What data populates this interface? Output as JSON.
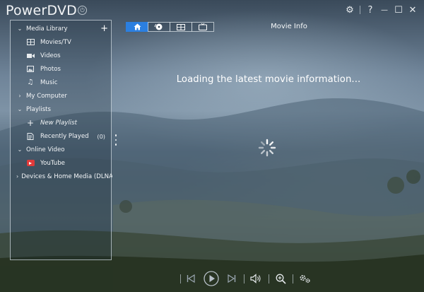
{
  "app": {
    "title": "PowerDVD",
    "badge_glyph": "⏻"
  },
  "window_controls": {
    "settings_glyph": "⚙",
    "help_glyph": "?",
    "minimize_glyph": "—",
    "maximize_glyph": "☐",
    "close_glyph": "✕"
  },
  "sidebar": {
    "media_library": {
      "label": "Media Library",
      "add_glyph": "+",
      "items": [
        {
          "label": "Movies/TV",
          "icon": "film-icon"
        },
        {
          "label": "Videos",
          "icon": "video-camera-icon"
        },
        {
          "label": "Photos",
          "icon": "photo-icon"
        },
        {
          "label": "Music",
          "icon": "music-note-icon"
        }
      ]
    },
    "my_computer": {
      "label": "My Computer"
    },
    "playlists": {
      "label": "Playlists",
      "new_playlist": "New Playlist",
      "recently_played": "Recently Played",
      "recently_played_count": "(0)"
    },
    "online_video": {
      "label": "Online Video",
      "youtube": "YouTube"
    },
    "devices": {
      "label": "Devices & Home Media (DLNA)"
    }
  },
  "tabs": [
    {
      "name": "home",
      "icon": "home-icon",
      "active": true
    },
    {
      "name": "disc",
      "icon": "disc-icon",
      "active": false
    },
    {
      "name": "film-strip",
      "icon": "film-strip-icon",
      "active": false
    },
    {
      "name": "tv",
      "icon": "tv-icon",
      "active": false
    }
  ],
  "panel": {
    "title": "Movie Info",
    "loading_message": "Loading the latest movie information..."
  },
  "colors": {
    "accent": "#2b7fe0",
    "youtube": "#e03a3a"
  }
}
